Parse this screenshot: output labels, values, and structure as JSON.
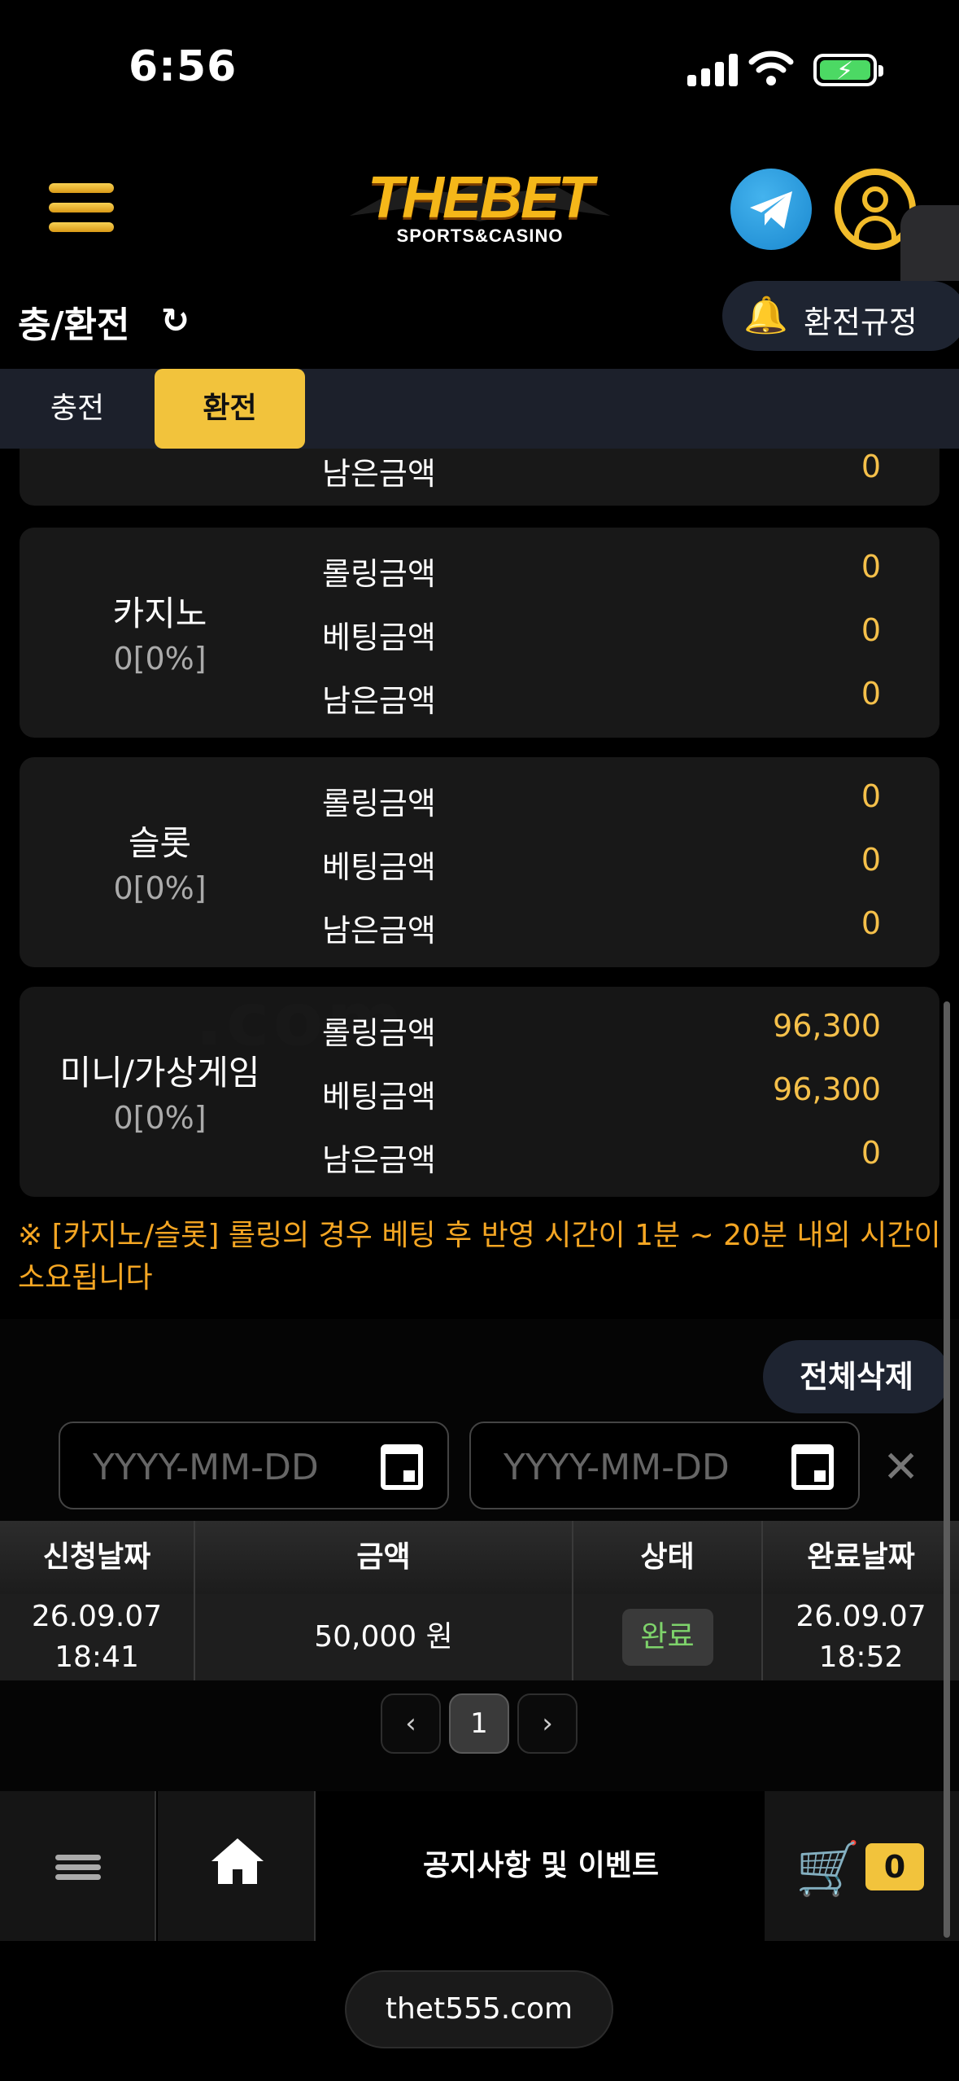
{
  "status_bar": {
    "time": "6:56"
  },
  "header": {
    "logo_text": "THEBET",
    "logo_subtext": "SPORTS&CASINO"
  },
  "title_row": {
    "title": "충/환전",
    "rules_label": "환전규정"
  },
  "tabs": [
    {
      "label": "충전",
      "active": false
    },
    {
      "label": "환전",
      "active": true
    }
  ],
  "rolling": {
    "partial_card": {
      "remaining_label": "남은금액",
      "remaining_value": "0"
    },
    "cards": [
      {
        "name": "카지노",
        "percent": "0[0%]",
        "rows": [
          {
            "label": "롤링금액",
            "value": "0"
          },
          {
            "label": "베팅금액",
            "value": "0"
          },
          {
            "label": "남은금액",
            "value": "0"
          }
        ]
      },
      {
        "name": "슬롯",
        "percent": "0[0%]",
        "rows": [
          {
            "label": "롤링금액",
            "value": "0"
          },
          {
            "label": "베팅금액",
            "value": "0"
          },
          {
            "label": "남은금액",
            "value": "0"
          }
        ]
      },
      {
        "name": "미니/가상게임",
        "percent": "0[0%]",
        "rows": [
          {
            "label": "롤링금액",
            "value": "96,300"
          },
          {
            "label": "베팅금액",
            "value": "96,300"
          },
          {
            "label": "남은금액",
            "value": "0"
          }
        ]
      }
    ]
  },
  "notice_text": "※ [카지노/슬롯] 롤링의 경우 베팅 후 반영 시간이 1분 ~ 20분 내외 시간이 소요됩니다",
  "history": {
    "delete_all_label": "전체삭제",
    "date_placeholder": "YYYY-MM-DD",
    "columns": [
      "신청날짜",
      "금액",
      "상태",
      "완료날짜"
    ],
    "rows": [
      {
        "request_date": "26.09.07",
        "request_time": "18:41",
        "amount": "50,000 원",
        "status": "완료",
        "complete_date": "26.09.07",
        "complete_time": "18:52"
      }
    ],
    "pagination": {
      "prev": "‹",
      "current": "1",
      "next": "›"
    }
  },
  "bottom_nav": {
    "notice_label": "공지사항 및 이벤트",
    "cart_count": "0"
  },
  "url": "thet555.com",
  "colors": {
    "accent": "#f2c33c",
    "value": "#f5c04a",
    "notice": "#f5a623",
    "status_done": "#7ed36b"
  }
}
